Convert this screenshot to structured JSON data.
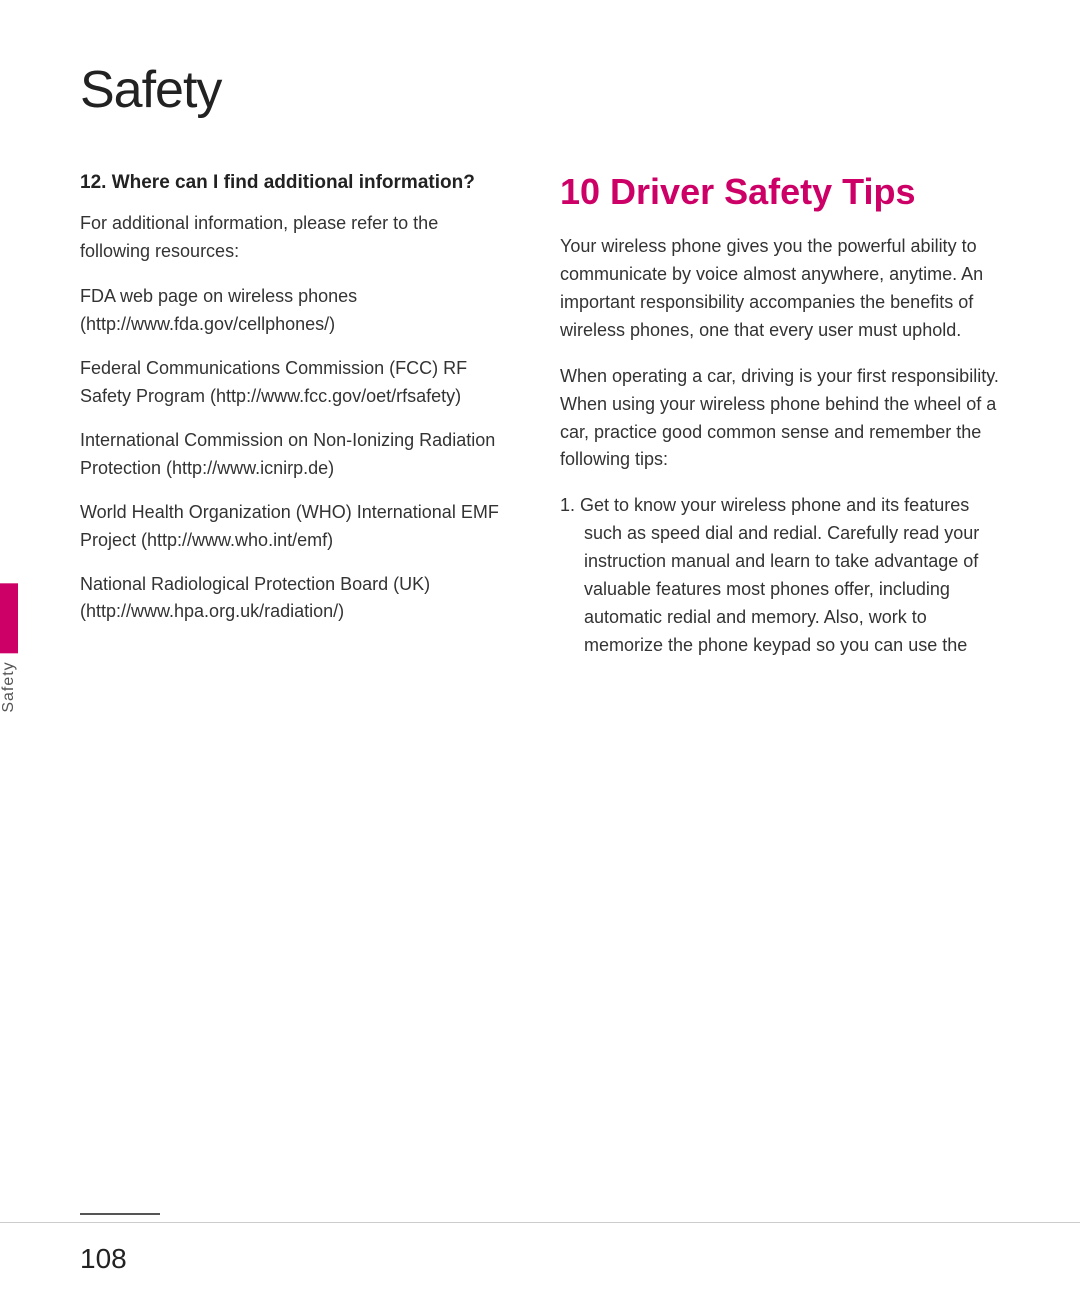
{
  "page": {
    "title": "Safety",
    "page_number": "108"
  },
  "side_tab": {
    "label": "Safety"
  },
  "left_column": {
    "section_heading": "12. Where can I find additional information?",
    "intro_text": "For additional information, please refer to the following resources:",
    "resources": [
      {
        "text": "FDA web page on wireless phones (http://www.fda.gov/cellphones/)"
      },
      {
        "text": "Federal Communications Commission (FCC) RF Safety Program (http://www.fcc.gov/oet/rfsafety)"
      },
      {
        "text": "International Commission on Non-Ionizing Radiation Protection (http://www.icnirp.de)"
      },
      {
        "text": "World Health Organization (WHO) International EMF Project (http://www.who.int/emf)"
      },
      {
        "text": "National Radiological Protection Board (UK) (http://www.hpa.org.uk/radiation/)"
      }
    ]
  },
  "right_column": {
    "heading": "10 Driver Safety Tips",
    "intro_paragraph_1": "Your wireless phone gives you the powerful ability to communicate by voice almost anywhere, anytime. An important responsibility accompanies the benefits of wireless phones, one that every user must uphold.",
    "intro_paragraph_2": "When operating a car, driving is your first responsibility. When using your wireless phone behind the wheel of a car, practice good common sense and remember the following tips:",
    "tip_1": "1. Get to know your wireless phone and its features such as speed dial and redial. Carefully read your instruction manual and learn to take advantage of valuable features most phones offer, including automatic redial and memory. Also, work to memorize the phone keypad so you can use the"
  },
  "colors": {
    "accent": "#cc0066",
    "text_primary": "#222222",
    "text_body": "#333333"
  }
}
